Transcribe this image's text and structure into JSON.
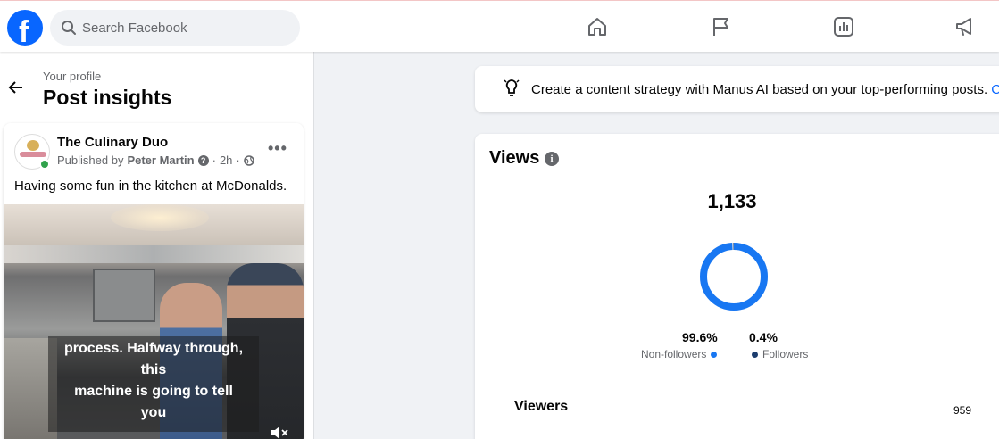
{
  "topbar": {
    "logo": "f",
    "search": {
      "placeholder": "Search Facebook",
      "value": ""
    },
    "nav_icons": [
      "home-icon",
      "flag-icon",
      "insights-icon",
      "megaphone-icon"
    ]
  },
  "left": {
    "breadcrumb": "Your profile",
    "title": "Post insights",
    "post": {
      "author": "The Culinary Duo",
      "published_prefix": "Published by",
      "published_by": "Peter Martin",
      "time": "2h",
      "separator": "·",
      "text": "Having some fun in the kitchen at McDonalds.",
      "caption_lines": [
        "process. Halfway through,",
        "this",
        "machine is going to tell",
        "you"
      ]
    }
  },
  "banner": {
    "text": "Create a content strategy with Manus AI based on your top-performing posts.",
    "link": "C"
  },
  "views": {
    "title": "Views",
    "total": "1,133",
    "non_followers_pct": "99.6%",
    "non_followers_label": "Non-followers",
    "followers_pct": "0.4%",
    "followers_label": "Followers",
    "viewers_label": "Viewers",
    "viewers_value": "959",
    "donut_share_non_followers": 0.996,
    "colors": {
      "non_followers": "#1877f2",
      "followers": "#1c3d6e",
      "accent": "#0866ff"
    }
  }
}
